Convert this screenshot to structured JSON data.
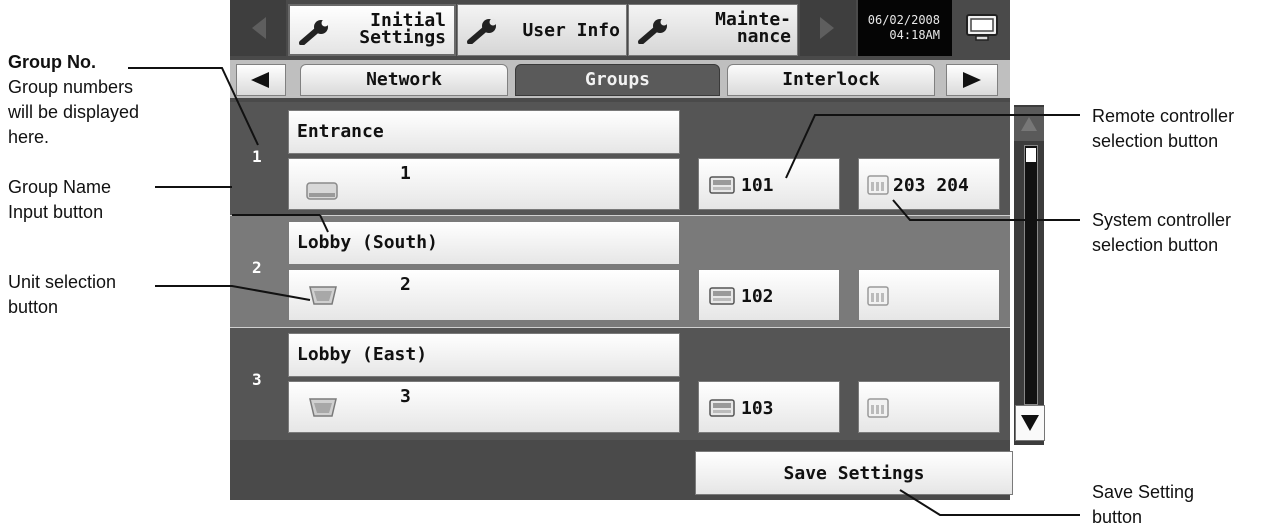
{
  "top_tabs": {
    "initial_settings": "Initial\nSettings",
    "user_info": "User Info",
    "maintenance": "Mainte-\nnance"
  },
  "datetime": {
    "date": "06/02/2008",
    "time": "04:18AM"
  },
  "sub_tabs": [
    "Network",
    "Groups",
    "Interlock"
  ],
  "groups": [
    {
      "number": "1",
      "name": "Entrance",
      "unit": "1",
      "remote": "101",
      "system": "203 204"
    },
    {
      "number": "2",
      "name": "Lobby (South)",
      "unit": "2",
      "remote": "102",
      "system": ""
    },
    {
      "number": "3",
      "name": "Lobby (East)",
      "unit": "3",
      "remote": "103",
      "system": ""
    }
  ],
  "save_button": "Save Settings",
  "annotations": {
    "group_no_title": "Group No.",
    "group_no_desc": [
      "Group numbers",
      "will be displayed",
      "here."
    ],
    "group_name": [
      "Group Name",
      "Input button"
    ],
    "unit_selection": [
      "Unit selection",
      "button"
    ],
    "remote_controller": [
      "Remote controller",
      "selection button"
    ],
    "system_controller": [
      "System controller",
      "selection button"
    ],
    "save_setting": [
      "Save Setting",
      "button"
    ]
  },
  "colors": {
    "screen_bg": "#4a4a4a",
    "selected_tab": "#5a5a5a",
    "button_face": "#f2f2f2"
  }
}
